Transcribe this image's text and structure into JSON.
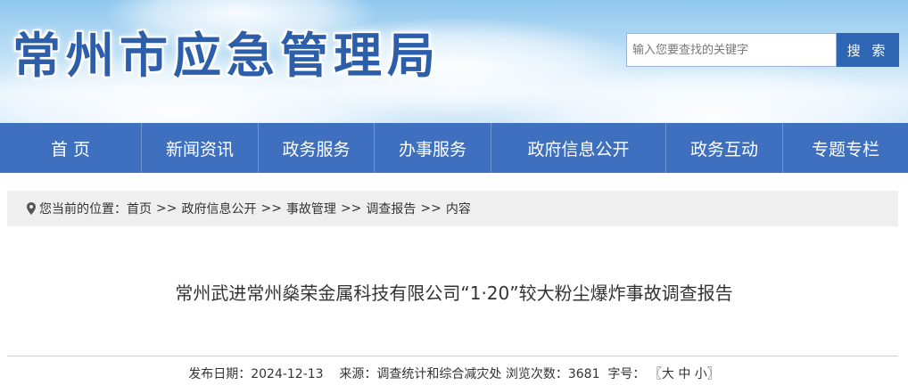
{
  "header": {
    "site_title": "常州市应急管理局",
    "search_placeholder": "输入您要查找的关键字",
    "search_button": "搜 索",
    "colors": {
      "title": "#2c5ea9",
      "search_button": "#2f66b3"
    }
  },
  "nav": {
    "color": "#3f70bf",
    "items": [
      {
        "label": "首 页"
      },
      {
        "label": "新闻资讯"
      },
      {
        "label": "政务服务"
      },
      {
        "label": "办事服务"
      },
      {
        "label": "政府信息公开"
      },
      {
        "label": "政务互动"
      },
      {
        "label": "专题专栏"
      }
    ]
  },
  "breadcrumb": {
    "icon": "location-pin-icon",
    "prefix": "您当前的位置：",
    "separator": ">>",
    "items": [
      "首页",
      "政府信息公开",
      "事故管理",
      "调查报告",
      "内容"
    ]
  },
  "article": {
    "title": "常州武进常州燊荣金属科技有限公司“1·20”较大粉尘爆炸事故调查报告",
    "meta": {
      "date_label": "发布日期：",
      "date": "2024-12-13",
      "source_label": "来源：",
      "source": "调查统计和综合减灾处",
      "views_label": "浏览次数：",
      "views": "3681",
      "fontsize_label": "字号：",
      "fontsize_open": "〖",
      "fontsize_large": "大",
      "fontsize_medium": "中",
      "fontsize_small": "小",
      "fontsize_close": "〗"
    }
  }
}
